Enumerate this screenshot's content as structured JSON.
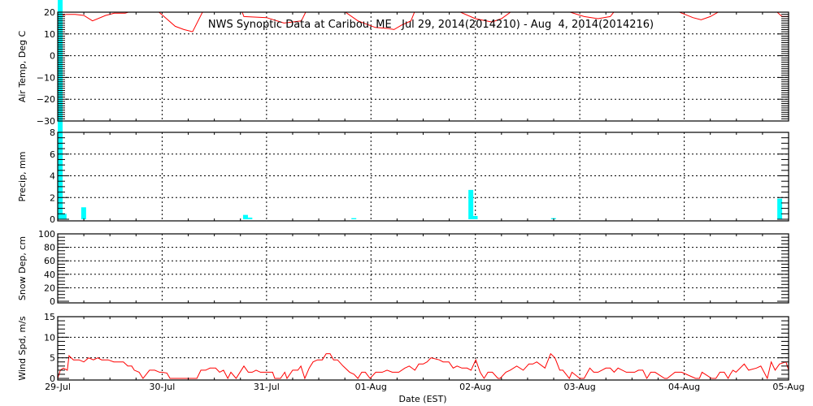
{
  "chart_data": [
    {
      "type": "line",
      "title": "NWS Synoptic Data at Caribou, ME   Jul 29, 2014(2014210) - Aug  4, 2014(2014216)",
      "ylabel": "Air Temp, Deg C",
      "xlabel": "Date (EST)",
      "x_unit": "hours since 29-Jul 00:00 EST",
      "xlim": [
        0,
        168
      ],
      "ylim": [
        -31,
        20
      ],
      "yticks": [
        20,
        10,
        0,
        -10,
        -20,
        -30
      ],
      "color": "#ff0000",
      "grid": true,
      "points": [
        [
          0,
          18
        ],
        [
          2,
          19
        ],
        [
          4,
          19
        ],
        [
          6,
          18.5
        ],
        [
          8,
          16
        ],
        [
          11,
          18.5
        ],
        [
          13,
          19.5
        ],
        [
          15.5,
          19.5
        ],
        [
          17,
          20.5
        ],
        [
          20,
          25
        ],
        [
          23,
          20.5
        ],
        [
          25,
          17
        ],
        [
          27,
          13.5
        ],
        [
          29,
          12
        ],
        [
          31,
          11
        ],
        [
          33.4,
          20.5
        ],
        [
          36,
          25
        ],
        [
          40,
          25
        ],
        [
          42.3,
          20.5
        ],
        [
          42.8,
          18
        ],
        [
          48,
          17.5
        ],
        [
          52,
          15
        ],
        [
          56,
          16
        ],
        [
          57.1,
          20.5
        ],
        [
          60,
          25
        ],
        [
          64,
          25
        ],
        [
          65.8,
          20.5
        ],
        [
          69,
          16
        ],
        [
          73,
          13
        ],
        [
          76,
          12.5
        ],
        [
          77.3,
          12
        ],
        [
          79,
          14
        ],
        [
          81.2,
          16
        ],
        [
          82.1,
          20.5
        ],
        [
          86,
          25
        ],
        [
          90,
          25
        ],
        [
          92,
          20.5
        ],
        [
          96,
          17
        ],
        [
          99.8,
          15.5
        ],
        [
          102,
          17
        ],
        [
          104.4,
          20.5
        ],
        [
          110,
          25
        ],
        [
          113,
          25
        ],
        [
          117,
          20.5
        ],
        [
          121,
          18
        ],
        [
          124.2,
          17
        ],
        [
          127,
          18
        ],
        [
          128,
          20.5
        ],
        [
          134,
          25
        ],
        [
          138,
          25
        ],
        [
          142.3,
          20.5
        ],
        [
          146,
          17.5
        ],
        [
          147.9,
          16.5
        ],
        [
          150,
          18
        ],
        [
          152.2,
          20.5
        ],
        [
          157,
          25
        ],
        [
          162,
          25
        ],
        [
          165.1,
          20.5
        ],
        [
          166.5,
          18
        ],
        [
          168,
          18
        ]
      ]
    },
    {
      "type": "bar",
      "ylabel": "Precip, mm",
      "x_unit": "hours since 29-Jul 00:00 EST",
      "xlim": [
        0,
        168
      ],
      "ylim": [
        0,
        8
      ],
      "yticks": [
        8,
        6,
        4,
        2,
        0
      ],
      "color": "#00ffff",
      "grid": true,
      "bars": [
        [
          0,
          21
        ],
        [
          0.9,
          0.5
        ],
        [
          5.4,
          1.1
        ],
        [
          42.6,
          0.4
        ],
        [
          43.6,
          0.15
        ],
        [
          67.5,
          0.1
        ],
        [
          94.4,
          2.7
        ],
        [
          95.4,
          0.3
        ],
        [
          113.4,
          0.1
        ],
        [
          165.4,
          1.9
        ]
      ]
    },
    {
      "type": "line",
      "ylabel": "Snow Dep, cm",
      "x_unit": "hours since 29-Jul 00:00 EST",
      "xlim": [
        0,
        168
      ],
      "ylim": [
        0,
        100
      ],
      "yticks": [
        100,
        80,
        60,
        40,
        20,
        0
      ],
      "grid": true,
      "points": []
    },
    {
      "type": "line",
      "ylabel": "Wind Spd, m/s",
      "xlabel": "Date (EST)",
      "x_unit": "hours since 29-Jul 00:00 EST",
      "xlim": [
        0,
        168
      ],
      "ylim": [
        0,
        15
      ],
      "yticks": [
        15,
        10,
        5,
        0
      ],
      "xticks": [
        "29-Jul",
        "30-Jul",
        "31-Jul",
        "01-Aug",
        "02-Aug",
        "03-Aug",
        "04-Aug",
        "05-Aug"
      ],
      "color": "#ff0000",
      "grid": true,
      "points": [
        [
          0,
          0
        ],
        [
          0.6,
          2
        ],
        [
          1.3,
          2.5
        ],
        [
          2.2,
          2
        ],
        [
          2.6,
          5.5
        ],
        [
          3.6,
          4.5
        ],
        [
          4.9,
          4.5
        ],
        [
          6,
          4
        ],
        [
          7.1,
          5
        ],
        [
          8.2,
          4.5
        ],
        [
          9.2,
          5
        ],
        [
          10.1,
          4.5
        ],
        [
          11.6,
          4.5
        ],
        [
          12.9,
          4
        ],
        [
          15.1,
          4
        ],
        [
          16.1,
          3
        ],
        [
          17,
          3
        ],
        [
          17.6,
          2
        ],
        [
          18.7,
          1.5
        ],
        [
          19.6,
          0
        ],
        [
          21.1,
          2
        ],
        [
          22.3,
          2
        ],
        [
          23.4,
          1.5
        ],
        [
          23.9,
          1.5
        ],
        [
          25.1,
          1.3
        ],
        [
          25.8,
          0
        ],
        [
          32,
          0
        ],
        [
          32.9,
          2
        ],
        [
          34,
          2
        ],
        [
          35,
          2.5
        ],
        [
          36.3,
          2.5
        ],
        [
          37.2,
          1.5
        ],
        [
          38.1,
          2
        ],
        [
          39.1,
          0
        ],
        [
          39.8,
          1.5
        ],
        [
          41,
          0
        ],
        [
          42.8,
          3
        ],
        [
          43.8,
          1.5
        ],
        [
          44.7,
          1.5
        ],
        [
          45.6,
          2
        ],
        [
          46.6,
          1.5
        ],
        [
          49.4,
          1.5
        ],
        [
          49.9,
          0
        ],
        [
          51.2,
          0
        ],
        [
          52.2,
          1.5
        ],
        [
          52.7,
          0
        ],
        [
          54,
          2
        ],
        [
          55.2,
          2
        ],
        [
          55.9,
          3
        ],
        [
          56.8,
          0
        ],
        [
          57.8,
          2.5
        ],
        [
          58.7,
          4
        ],
        [
          59.7,
          4.5
        ],
        [
          60.8,
          4.5
        ],
        [
          61.7,
          6
        ],
        [
          62.6,
          6
        ],
        [
          63.4,
          4.5
        ],
        [
          64.3,
          4.5
        ],
        [
          65.6,
          3
        ],
        [
          67.1,
          1.5
        ],
        [
          68.1,
          1
        ],
        [
          69,
          0
        ],
        [
          69.9,
          1.5
        ],
        [
          70.7,
          1.5
        ],
        [
          71.8,
          0
        ],
        [
          73.1,
          1.5
        ],
        [
          74.6,
          1.5
        ],
        [
          75.7,
          2
        ],
        [
          76.9,
          1.5
        ],
        [
          78.4,
          1.5
        ],
        [
          79.8,
          2.5
        ],
        [
          80.8,
          3
        ],
        [
          82.1,
          2
        ],
        [
          83,
          3.5
        ],
        [
          84,
          3.5
        ],
        [
          84.9,
          4
        ],
        [
          85.8,
          5
        ],
        [
          87.7,
          4.5
        ],
        [
          88.6,
          4
        ],
        [
          89.9,
          4
        ],
        [
          90.9,
          2.5
        ],
        [
          91.8,
          3
        ],
        [
          92.9,
          2.5
        ],
        [
          94.1,
          2.5
        ],
        [
          95,
          2
        ],
        [
          96.1,
          4.5
        ],
        [
          97.1,
          1.5
        ],
        [
          98,
          0
        ],
        [
          98.9,
          1.5
        ],
        [
          99.9,
          1.5
        ],
        [
          101.2,
          0
        ],
        [
          101.7,
          0
        ],
        [
          103,
          1.5
        ],
        [
          104,
          2
        ],
        [
          105.5,
          3
        ],
        [
          107,
          2
        ],
        [
          108.3,
          3.5
        ],
        [
          109.2,
          3.5
        ],
        [
          110.1,
          4
        ],
        [
          112,
          2.5
        ],
        [
          113.3,
          6
        ],
        [
          114.3,
          5
        ],
        [
          115.4,
          2
        ],
        [
          116.1,
          2
        ],
        [
          117.6,
          0
        ],
        [
          118.2,
          1.5
        ],
        [
          120,
          0
        ],
        [
          121,
          0
        ],
        [
          122.3,
          2.5
        ],
        [
          123.2,
          1.5
        ],
        [
          124.2,
          1.5
        ],
        [
          126,
          2.5
        ],
        [
          127,
          2.5
        ],
        [
          127.9,
          1.5
        ],
        [
          128.8,
          2.5
        ],
        [
          130.7,
          1.5
        ],
        [
          132.6,
          1.5
        ],
        [
          133.5,
          2
        ],
        [
          134.5,
          2
        ],
        [
          135.4,
          0
        ],
        [
          136.3,
          1.5
        ],
        [
          137.3,
          1.5
        ],
        [
          139.5,
          0
        ],
        [
          140.1,
          0
        ],
        [
          141.9,
          1.5
        ],
        [
          143.4,
          1.5
        ],
        [
          146.6,
          0
        ],
        [
          147.5,
          0
        ],
        [
          148.1,
          1.5
        ],
        [
          150.3,
          0
        ],
        [
          151.3,
          0
        ],
        [
          152.2,
          1.5
        ],
        [
          153.2,
          1.5
        ],
        [
          154.1,
          0
        ],
        [
          154.6,
          1
        ],
        [
          155.2,
          2
        ],
        [
          155.9,
          1.5
        ],
        [
          157.8,
          3.5
        ],
        [
          158.8,
          2
        ],
        [
          160.6,
          2.5
        ],
        [
          161.6,
          3
        ],
        [
          163.1,
          0
        ],
        [
          164,
          4
        ],
        [
          164.9,
          2
        ],
        [
          165.9,
          3.5
        ],
        [
          167.4,
          4
        ],
        [
          168,
          2
        ]
      ]
    }
  ]
}
